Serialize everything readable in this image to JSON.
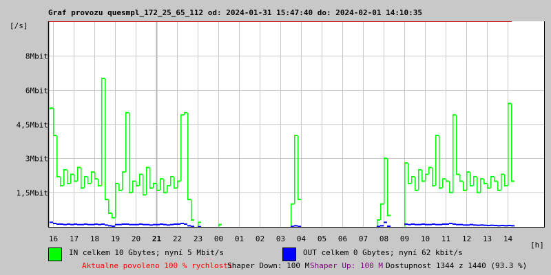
{
  "chart_data": {
    "type": "bar",
    "title": "Graf provozu quesmpl_172_25_65_112 od: 2024-01-31 15:47:40 do: 2024-02-01 14:10:35",
    "ylabel": "[/s]",
    "xlabel": "[h]",
    "ylim": [
      0,
      9
    ],
    "y_ticks": [
      {
        "value": 1.5,
        "label": "1,5Mbit"
      },
      {
        "value": 3,
        "label": "3Mbit"
      },
      {
        "value": 4.5,
        "label": "4,5Mbit"
      },
      {
        "value": 6,
        "label": "6Mbit"
      },
      {
        "value": 7.5,
        "label": "8Mbit"
      }
    ],
    "x_ticks": [
      "16",
      "17",
      "18",
      "19",
      "20",
      "21",
      "22",
      "23",
      "00",
      "01",
      "02",
      "03",
      "04",
      "05",
      "06",
      "07",
      "08",
      "09",
      "10",
      "11",
      "12",
      "13",
      "14"
    ],
    "x_tick_bold": "21",
    "sample_start": "15:50",
    "sample_interval_min": 10,
    "series": [
      {
        "name": "IN",
        "color": "#00ff00",
        "values": [
          5.2,
          4.0,
          2.2,
          1.8,
          2.5,
          1.9,
          2.3,
          2.0,
          2.6,
          1.7,
          2.2,
          1.9,
          2.4,
          2.1,
          1.8,
          6.5,
          1.2,
          0.6,
          0.4,
          1.9,
          1.6,
          2.4,
          5.0,
          1.5,
          2.0,
          1.8,
          2.3,
          1.4,
          2.6,
          1.7,
          1.9,
          1.6,
          2.1,
          1.5,
          1.8,
          2.2,
          1.7,
          2.0,
          4.9,
          5.0,
          1.2,
          0.3,
          0.0,
          0.2,
          0,
          0,
          0,
          0,
          0,
          0.1,
          0,
          0,
          0,
          0,
          0,
          0,
          0,
          0,
          0,
          0,
          0,
          0,
          0,
          0,
          0,
          0,
          0,
          0,
          0,
          0,
          1.0,
          4.0,
          1.2,
          0,
          0,
          0,
          0,
          0,
          0,
          0,
          0,
          0,
          0,
          0,
          0,
          0,
          0,
          0,
          0,
          0,
          0,
          0,
          0,
          0,
          0,
          0.3,
          1.0,
          3.0,
          0.5,
          0,
          0,
          0,
          0,
          2.8,
          1.9,
          2.2,
          1.6,
          2.5,
          2.0,
          2.3,
          2.6,
          1.8,
          4.0,
          1.7,
          2.1,
          2.0,
          1.5,
          4.9,
          2.3,
          2.0,
          1.6,
          2.4,
          1.8,
          2.2,
          1.5,
          2.1,
          1.9,
          1.7,
          2.2,
          2.0,
          1.6,
          2.3,
          1.8,
          5.4,
          2.0
        ]
      },
      {
        "name": "OUT",
        "color": "#0000ff",
        "values": [
          0.2,
          0.15,
          0.12,
          0.12,
          0.1,
          0.12,
          0.1,
          0.12,
          0.1,
          0.1,
          0.12,
          0.1,
          0.1,
          0.12,
          0.1,
          0.12,
          0.08,
          0.05,
          0.03,
          0.1,
          0.1,
          0.12,
          0.12,
          0.1,
          0.1,
          0.1,
          0.12,
          0.1,
          0.1,
          0.08,
          0.1,
          0.1,
          0.12,
          0.1,
          0.08,
          0.1,
          0.12,
          0.12,
          0.15,
          0.12,
          0.05,
          0.02,
          0,
          0.01,
          0,
          0,
          0,
          0,
          0,
          0,
          0,
          0,
          0,
          0,
          0,
          0,
          0,
          0,
          0,
          0,
          0,
          0,
          0,
          0,
          0,
          0,
          0,
          0,
          0,
          0,
          0.02,
          0.05,
          0.02,
          0,
          0,
          0,
          0,
          0,
          0,
          0,
          0,
          0,
          0,
          0,
          0,
          0,
          0,
          0,
          0,
          0,
          0,
          0,
          0,
          0,
          0,
          0.02,
          0.05,
          0.2,
          0.03,
          0,
          0,
          0,
          0,
          0.12,
          0.1,
          0.12,
          0.1,
          0.1,
          0.12,
          0.1,
          0.1,
          0.12,
          0.1,
          0.1,
          0.12,
          0.12,
          0.15,
          0.12,
          0.1,
          0.1,
          0.08,
          0.08,
          0.1,
          0.08,
          0.07,
          0.08,
          0.07,
          0.06,
          0.07,
          0.06,
          0.05,
          0.06,
          0.05,
          0.06,
          0.05
        ]
      }
    ]
  },
  "legend": {
    "in_label": "IN celkem 10 Gbytes; nyní 5 Mbit/s",
    "out_label": "OUT celkem 0 Gbytes; nyní 62 kbit/s"
  },
  "status": {
    "allowed": "Aktualne povoleno 100 % rychlosti",
    "shaper_down": "Shaper Down: 100 M",
    "shaper_up": "Shaper Up: 100 M",
    "availability": "Dostupnost 1344 z 1440 (93.3 %)"
  }
}
